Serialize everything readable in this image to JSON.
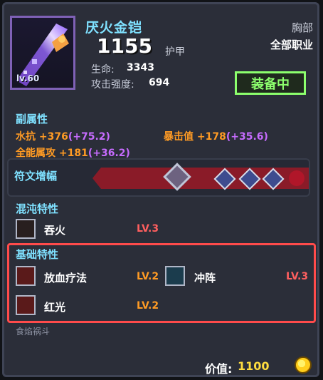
{
  "item": {
    "name": "厌火金铠",
    "armor_value": "1155",
    "armor_label": "护甲",
    "slot": "胸部",
    "job": "全部职业",
    "level": "lv.60",
    "stats": [
      {
        "label": "生命:",
        "value": "3343"
      },
      {
        "label": "攻击强度:",
        "value": "694"
      }
    ],
    "status_button": "装备中"
  },
  "sub_attributes": {
    "title": "副属性",
    "left": [
      {
        "text": "水抗 +376",
        "extra": "(+75.2)"
      },
      {
        "text": "全能属攻 +181",
        "extra": "(+36.2)"
      }
    ],
    "right": [
      {
        "text": "暴击值 +178",
        "extra": "(+35.6)"
      }
    ]
  },
  "runes": {
    "label": "符文增幅"
  },
  "chaos_traits": {
    "title": "混沌特性",
    "items": [
      {
        "name": "吞火",
        "level": "LV.3",
        "icon": "flame-face-icon"
      }
    ]
  },
  "basic_traits": {
    "title": "基础特性",
    "items": [
      {
        "name": "放血疗法",
        "level": "LV.2",
        "icon": "blood-icon"
      },
      {
        "name": "冲阵",
        "level": "LV.3",
        "icon": "wind-icon"
      },
      {
        "name": "红光",
        "level": "LV.2",
        "icon": "red-light-icon"
      }
    ]
  },
  "footer": {
    "set_name": "食焰祸斗",
    "value_label": "价值:",
    "value": "1100"
  }
}
